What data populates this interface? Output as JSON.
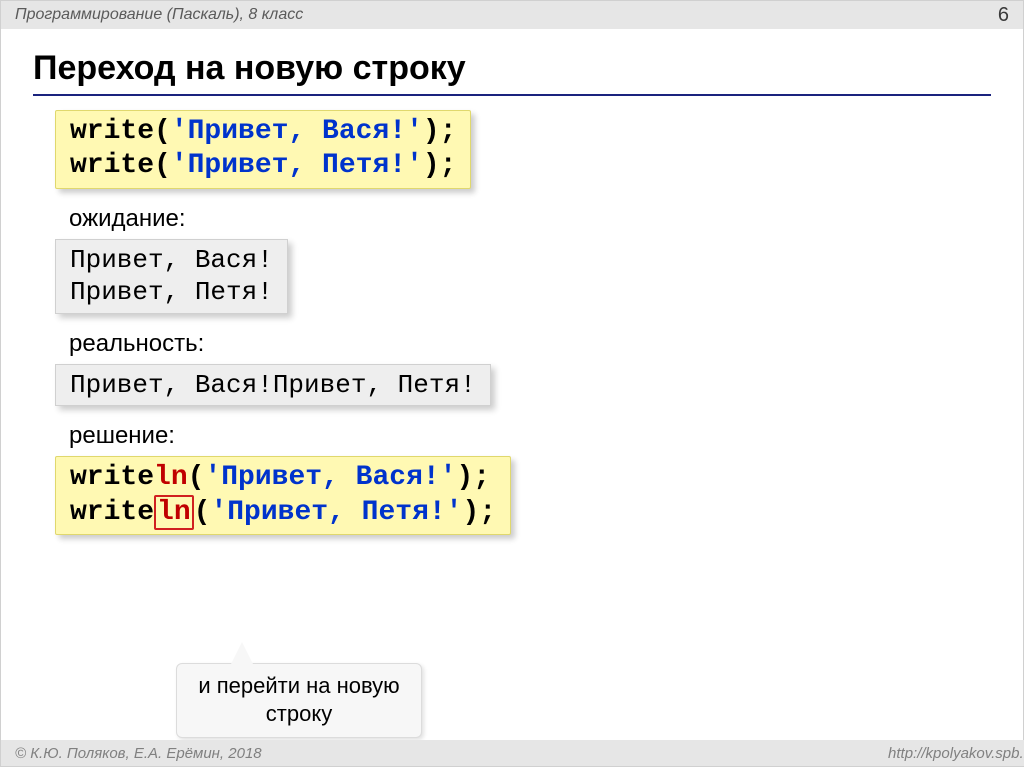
{
  "header": {
    "left": "Программирование (Паскаль), 8 класс",
    "page_num": "6"
  },
  "title": "Переход на новую строку",
  "code1": {
    "l1_a": "write(",
    "l1_b": "'Привет, Вася!'",
    "l1_c": ");",
    "l2_a": "write(",
    "l2_b": "'Привет, Петя!'",
    "l2_c": ");"
  },
  "labels": {
    "expect": "ожидание:",
    "real": "реальность:",
    "sol": "решение:"
  },
  "out_expect": {
    "l1": "Привет, Вася!",
    "l2": "Привет, Петя!"
  },
  "out_real": "Привет, Вася!Привет, Петя!",
  "code2": {
    "l1_a": "write",
    "l1_ln": "ln",
    "l1_b": "(",
    "l1_c": "'Привет, Вася!'",
    "l1_d": ");",
    "l2_a": "write",
    "l2_ln": "ln",
    "l2_b": "(",
    "l2_c": "'Привет, Петя!'",
    "l2_d": ");"
  },
  "callout": "и перейти на новую строку",
  "footer": {
    "left": "© К.Ю. Поляков, Е.А. Ерёмин, 2018",
    "right": "http://kpolyakov.spb.ru"
  }
}
